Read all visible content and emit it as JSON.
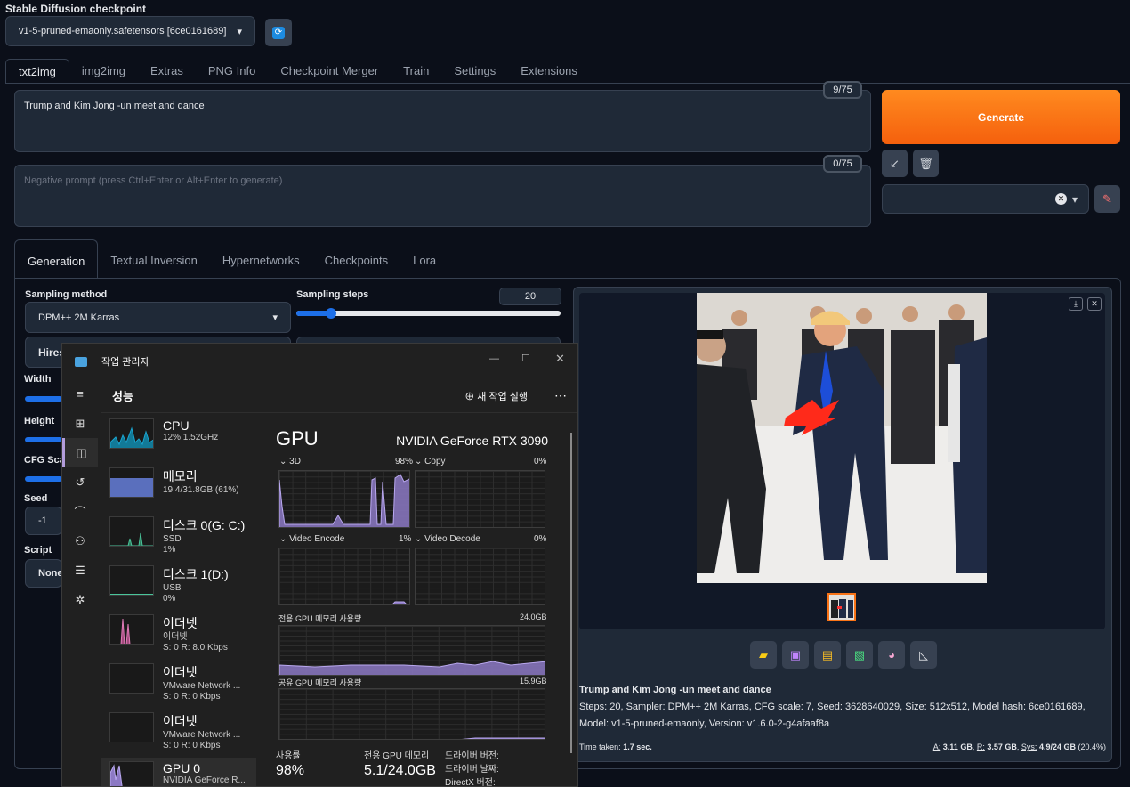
{
  "checkpoint": {
    "label": "Stable Diffusion checkpoint",
    "value": "v1-5-pruned-emaonly.safetensors [6ce0161689]"
  },
  "tabs": [
    "txt2img",
    "img2img",
    "Extras",
    "PNG Info",
    "Checkpoint Merger",
    "Train",
    "Settings",
    "Extensions"
  ],
  "prompt": {
    "text": "Trump and Kim Jong -un meet and dance",
    "counter": "9/75"
  },
  "negative": {
    "placeholder": "Negative prompt (press Ctrl+Enter or Alt+Enter to generate)",
    "counter": "0/75"
  },
  "generate_label": "Generate",
  "subtabs": [
    "Generation",
    "Textual Inversion",
    "Hypernetworks",
    "Checkpoints",
    "Lora"
  ],
  "params": {
    "sampling_method_label": "Sampling method",
    "sampling_method": "DPM++ 2M Karras",
    "steps_label": "Sampling steps",
    "steps": "20",
    "steps_fraction": 0.13,
    "hires": "Hires.",
    "width_label": "Width",
    "height_label": "Height",
    "cfg_label": "CFG Scal",
    "seed_label": "Seed",
    "seed": "-1",
    "script_label": "Script",
    "script": "None"
  },
  "output": {
    "prompt": "Trump and Kim Jong -un meet and dance",
    "info": "Steps: 20, Sampler: DPM++ 2M Karras, CFG scale: 7, Seed: 3628640029, Size: 512x512, Model hash: 6ce0161689, Model: v1-5-pruned-emaonly, Version: v1.6.0-2-g4afaaf8a",
    "time_label": "Time taken:",
    "time": "1.7 sec.",
    "mem_a": "A:",
    "mem_a_val": "3.11 GB",
    "mem_r": "R:",
    "mem_r_val": "3.57 GB",
    "mem_sys": "Sys:",
    "mem_sys_val": "4.9/24 GB",
    "mem_pct": "(20.4%)"
  },
  "taskmgr": {
    "title": "작업 관리자",
    "section": "성능",
    "new_task": "새 작업 실행",
    "resources": [
      {
        "name": "CPU",
        "l1": "12% 1.52GHz",
        "l2": ""
      },
      {
        "name": "메모리",
        "l1": "19.4/31.8GB (61%)",
        "l2": ""
      },
      {
        "name": "디스크 0(G: C:)",
        "l1": "SSD",
        "l2": "1%"
      },
      {
        "name": "디스크 1(D:)",
        "l1": "USB",
        "l2": "0%"
      },
      {
        "name": "이더넷",
        "l1": "이더넷",
        "l2": "S: 0 R: 8.0 Kbps"
      },
      {
        "name": "이더넷",
        "l1": "VMware Network ...",
        "l2": "S: 0 R: 0 Kbps"
      },
      {
        "name": "이더넷",
        "l1": "VMware Network ...",
        "l2": "S: 0 R: 0 Kbps"
      },
      {
        "name": "GPU 0",
        "l1": "NVIDIA GeForce R...",
        "l2": ""
      }
    ],
    "gpu_title": "GPU",
    "gpu_model": "NVIDIA GeForce RTX 3090",
    "engines": [
      {
        "name": "3D",
        "pct": "98%"
      },
      {
        "name": "Copy",
        "pct": "0%"
      },
      {
        "name": "Video Encode",
        "pct": "1%"
      },
      {
        "name": "Video Decode",
        "pct": "0%"
      }
    ],
    "dedicated_label": "전용 GPU 메모리 사용량",
    "dedicated_max": "24.0GB",
    "shared_label": "공유 GPU 메모리 사용량",
    "shared_max": "15.9GB",
    "util_label": "사용률",
    "util": "98%",
    "mem_label": "전용 GPU 메모리",
    "mem": "5.1/24.0GB",
    "driver_ver": "드라이버 버전:",
    "driver_date": "드라이버 날짜:",
    "directx": "DirectX 버전:"
  }
}
